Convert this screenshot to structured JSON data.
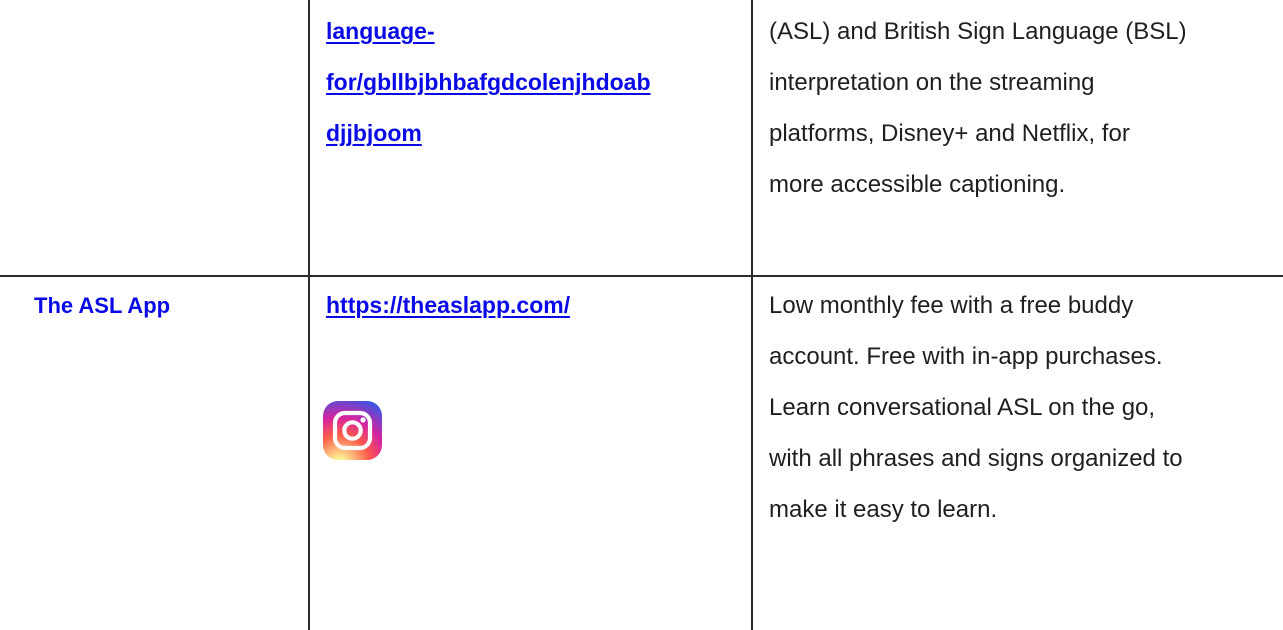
{
  "row_top": {
    "link_lines": [
      "language-",
      "for/gbllbjbhbafgdcolenjhdoab",
      "djjbjoom"
    ],
    "description_lines": [
      "(ASL) and British Sign Language (BSL)",
      "interpretation on the streaming",
      "platforms, Disney+ and Netflix, for",
      "more accessible captioning."
    ]
  },
  "row_asl_app": {
    "name": "The ASL App",
    "link": "https://theaslapp.com/",
    "icon": "instagram-icon",
    "description_lines": [
      "Low monthly fee with a free buddy",
      "account. Free with in-app purchases.",
      "Learn conversational ASL on the go,",
      "with all phrases and signs organized to",
      "make it easy to learn."
    ]
  },
  "colors": {
    "link": "#0a0ae6",
    "border": "#2b2b2b",
    "text": "#1f1f1f"
  }
}
